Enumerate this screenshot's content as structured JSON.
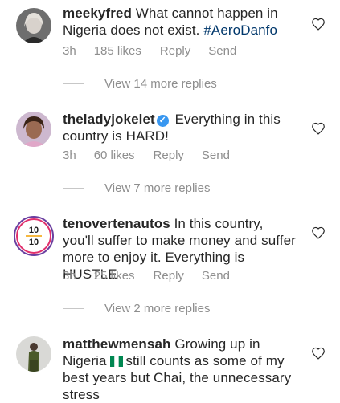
{
  "comments": [
    {
      "username": "meekyfred",
      "text": "What cannot happen in Nigeria does not exist.",
      "hashtag": "#AeroDanfo",
      "time": "3h",
      "likes": "185 likes",
      "reply": "Reply",
      "send": "Send",
      "view_replies": "View 14 more replies",
      "avatar_icon": "avatar-woman-photo"
    },
    {
      "username": "theladyjokelet",
      "text": "Everything in this country is HARD!",
      "time": "3h",
      "likes": "60 likes",
      "reply": "Reply",
      "send": "Send",
      "view_replies": "View 7 more replies",
      "avatar_icon": "avatar-woman-photo",
      "verified": true
    },
    {
      "username": "tenovertenautos",
      "text": "In this country, you'll suffer to make money and suffer more to enjoy it. Everything is HUSTLE",
      "time": "3h",
      "likes": "25 likes",
      "reply": "Reply",
      "send": "Send",
      "view_replies": "View 2 more replies",
      "avatar_icon": "ten-over-ten-logo"
    },
    {
      "username": "matthewmensah",
      "text_before_flag": "Growing up in Nigeria",
      "text_after_flag": "still counts as some of my best years but Chai, the unnecessary stress",
      "avatar_icon": "avatar-man-photo"
    }
  ],
  "colors": {
    "text": "#262626",
    "meta": "#8e8e8e",
    "hashtag": "#00376b",
    "verified": "#3897f0",
    "flag_green": "#008751"
  }
}
